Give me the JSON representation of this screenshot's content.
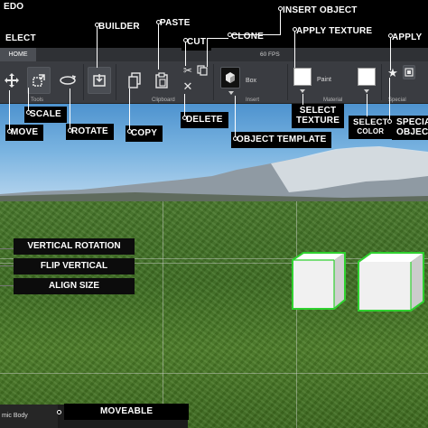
{
  "topbar": {
    "home_tab": "HOME",
    "fps": "60 FPS"
  },
  "toolbar": {
    "groups": {
      "tools": "Tools",
      "clipboard": "Clipboard",
      "insert": "Insert",
      "material": "Material",
      "special": "Special"
    },
    "insert_object_name": "Box",
    "paint_label": "Paint"
  },
  "callouts": {
    "redo": "EDO",
    "select": "ELECT",
    "builder": "BUILDER",
    "paste": "PASTE",
    "cut": "CUT",
    "clone": "CLONE",
    "insert_object": "INSERT OBJECT",
    "apply_texture": "APPLY TEXTURE",
    "apply": "APPLY",
    "scale": "SCALE",
    "move": "MOVE",
    "rotate": "ROTATE",
    "copy": "COPY",
    "delete": "DELETE",
    "object_template": "OBJECT TEMPLATE",
    "select_texture_1": "SELECT",
    "select_texture_2": "TEXTURE",
    "select_color_1": "SELECT",
    "select_color_2": "COLOR",
    "special_object_1": "SPECIA",
    "special_object_2": "OBJEC"
  },
  "panel": {
    "vertical_rotation": "VERTICAL ROTATION",
    "flip_vertical": "FLIP VERTICAL",
    "align_size": "ALIGN SIZE",
    "moveable": "MOVEABLE"
  },
  "bottom": {
    "body_type": "mic Body"
  },
  "icons": [
    "move-icon",
    "scale-icon",
    "rotate-icon",
    "builder-icon",
    "copy-icon",
    "paste-icon",
    "cut-icon",
    "delete-icon",
    "clone-icon",
    "box-icon",
    "star-icon",
    "special-object-icon"
  ],
  "colors": {
    "selection_outline": "#2fd12f",
    "label_bg": "#000000",
    "toolbar_bg": "#3a3c41"
  }
}
